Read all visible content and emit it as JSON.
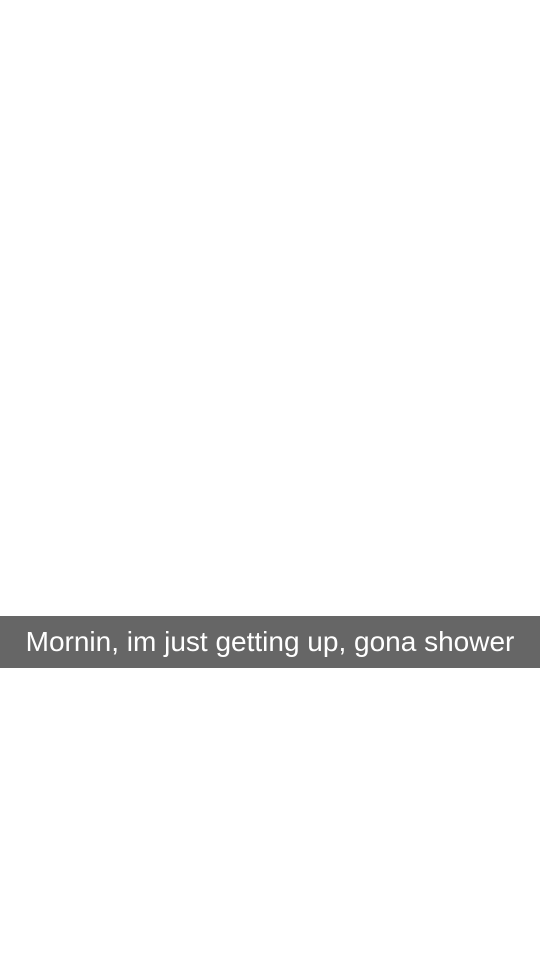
{
  "caption": {
    "text": "Mornin, im just getting up, gona shower",
    "background_color": "#666666",
    "text_color": "#ffffff"
  },
  "background_color": "#ffffff"
}
